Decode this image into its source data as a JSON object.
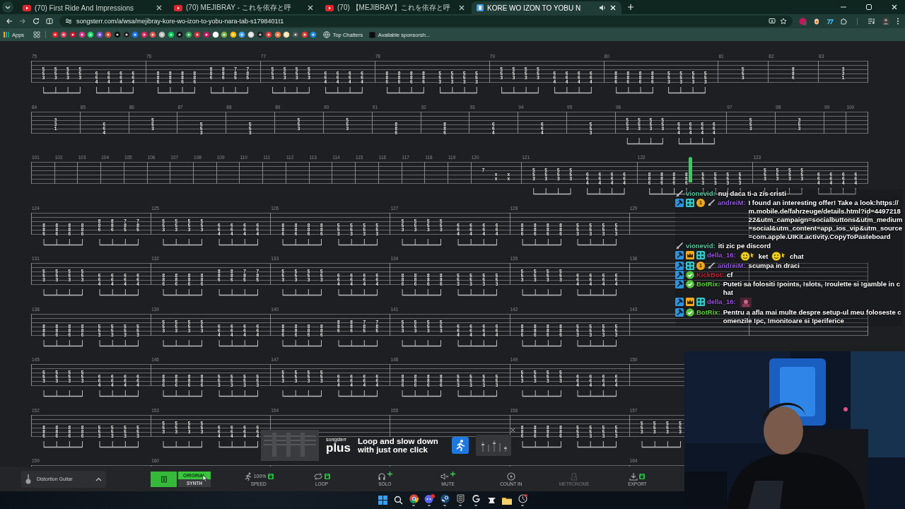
{
  "browser": {
    "tabs": [
      {
        "title": "(70) First Ride And Impressions",
        "kind": "video",
        "selected": false,
        "audio": false
      },
      {
        "title": "(70) MEJIBRAY - これを依存と呼",
        "kind": "video",
        "selected": false,
        "audio": false
      },
      {
        "title": "(70) 【MEJIBRAY】これを依存と呼",
        "kind": "video",
        "selected": false,
        "audio": false
      },
      {
        "title": "KORE WO IZON TO YOBU N",
        "kind": "site",
        "selected": true,
        "audio": true
      }
    ],
    "url": "songsterr.com/a/wsa/mejibray-kore-wo-izon-to-yobu-nara-tab-s1798401t1",
    "bookmarks": {
      "apps": "Apps",
      "links": [
        {
          "label": "Top Chatters"
        },
        {
          "label": "Available sponsorsh..."
        }
      ]
    }
  },
  "tab_sheet": {
    "systems": [
      {
        "measures": [
          {
            "number": "75",
            "chords": [
              "  553 ",
              "  553 ",
              "  553 ",
              "  553 ",
              "   664",
              "   664",
              "   664",
              "   664"
            ]
          },
          {
            "number": "76",
            "chords": [
              "   886",
              "   886",
              "   886",
              "   886",
              "  886 ",
              "  886 ",
              "  785 ",
              "  785 "
            ]
          },
          {
            "number": "77",
            "chords": [
              "  553 ",
              "  553 ",
              "  553 ",
              "  553 ",
              "   664",
              "   664",
              "   664",
              "   664"
            ]
          },
          {
            "number": "78",
            "chords": [
              "   886",
              "   886",
              "   886",
              "   886",
              "   553",
              "   553",
              "   553",
              "   553"
            ]
          },
          {
            "number": "79",
            "chords": [
              "  553 ",
              "  553 ",
              "  553 ",
              "  553 ",
              "   664",
              "   664",
              "   664",
              "   664"
            ]
          },
          {
            "number": "80",
            "chords": [
              "   886",
              "   886",
              "   886",
              "   886",
              "   553",
              "   553",
              "   553",
              "   553"
            ]
          },
          {
            "number": "81",
            "chords": [
              "  553 "
            ]
          },
          {
            "number": "82",
            "chords": [
              "  886 "
            ]
          },
          {
            "number": "83",
            "chords": [
              "  331 "
            ]
          }
        ]
      },
      {
        "measures": [
          {
            "number": "84",
            "chords": [
              "  331 "
            ]
          },
          {
            "number": "85",
            "chords": [
              "   664"
            ]
          },
          {
            "number": "86",
            "chords": [
              "  553 "
            ]
          },
          {
            "number": "87",
            "chords": [
              "   553"
            ]
          },
          {
            "number": "88",
            "chords": [
              "   553"
            ]
          },
          {
            "number": "89",
            "chords": [
              "  553 "
            ]
          },
          {
            "number": "90",
            "chords": [
              "  553 "
            ]
          },
          {
            "number": "91",
            "chords": [
              "   886"
            ]
          },
          {
            "number": "92",
            "chords": [
              "   886"
            ]
          },
          {
            "number": "93",
            "chords": [
              "   664"
            ]
          },
          {
            "number": "94",
            "chords": [
              "   664"
            ]
          },
          {
            "number": "95",
            "chords": [
              "   553"
            ]
          },
          {
            "number": "96",
            "chords": [
              "  553 ",
              "  553 ",
              "  553 ",
              "  553 ",
              "   664",
              "   664",
              "   664",
              "   664"
            ]
          },
          {
            "number": "97",
            "chords": [
              "  553 "
            ]
          },
          {
            "number": "98",
            "chords": [
              "  353 "
            ]
          },
          {
            "number": "99"
          },
          {
            "number": "100"
          }
        ]
      },
      {
        "measures": [
          {
            "number": "101"
          },
          {
            "number": "102"
          },
          {
            "number": "103"
          },
          {
            "number": "104"
          },
          {
            "number": "105"
          },
          {
            "number": "106"
          },
          {
            "number": "107"
          },
          {
            "number": "108"
          },
          {
            "number": "109"
          },
          {
            "number": "110"
          },
          {
            "number": "111"
          },
          {
            "number": "112"
          },
          {
            "number": "113"
          },
          {
            "number": "114"
          },
          {
            "number": "115"
          },
          {
            "number": "116"
          },
          {
            "number": "117"
          },
          {
            "number": "118"
          },
          {
            "number": "119"
          },
          {
            "number": "120",
            "chords": [
              "  7   ",
              "   x x",
              "   x x"
            ]
          },
          {
            "number": "121",
            "chords": [
              "  553 ",
              "  553 ",
              "  553 ",
              "  553 ",
              "   664",
              "   664",
              "   664",
              "   664"
            ]
          },
          {
            "number": "122",
            "chords": [
              "   886",
              "   886",
              "   886",
              "   886",
              "   553",
              "   553",
              "   553",
              "   553"
            ]
          },
          {
            "number": "123",
            "chords": [
              "  553 ",
              "  553 ",
              "  553 ",
              "  553 ",
              "   664",
              "   664",
              "   664",
              "   664"
            ]
          }
        ]
      },
      {
        "measures": [
          {
            "number": "124",
            "chords": [
              "   886",
              "   886",
              "   886",
              "   886",
              "  886 ",
              "  886 ",
              "  785 ",
              "  785 "
            ]
          },
          {
            "number": "125",
            "chords": [
              "  553 ",
              "  553 ",
              "  553 ",
              "  553 ",
              "   664",
              "   664",
              "   664",
              "   664"
            ]
          },
          {
            "number": "126",
            "chords": [
              "   886",
              "   886",
              "   886",
              "   886",
              "   553",
              "   553",
              "   553",
              "   553"
            ]
          },
          {
            "number": "127",
            "chords": [
              "  553 ",
              "  553 ",
              "  553 ",
              "  553 ",
              "   664",
              "   664",
              "   664",
              "   664"
            ]
          },
          {
            "number": "128",
            "chords": [
              "   886",
              "   886",
              "   886",
              "   886",
              "   553",
              "   553",
              "   553",
              "   553"
            ]
          },
          {
            "number": "129",
            "covered": true
          },
          {
            "covered": true
          }
        ]
      },
      {
        "measures": [
          {
            "number": "131",
            "chords": [
              "  553 ",
              "  553 ",
              "  553 ",
              "  553 ",
              "   664",
              "   664",
              "   664",
              "   664"
            ]
          },
          {
            "number": "132",
            "chords": [
              "   886",
              "   886",
              "   886",
              "   886",
              "  886 ",
              "  886 ",
              "  785 ",
              "  785 "
            ]
          },
          {
            "number": "133",
            "chords": [
              "  553 ",
              "  553 ",
              "  553 ",
              "  553 ",
              "   664",
              "   664",
              "   664",
              "   664"
            ]
          },
          {
            "number": "134",
            "chords": [
              "   886",
              "   886",
              "   886",
              "   886",
              "   553",
              "   553",
              "   553",
              "   553"
            ]
          },
          {
            "number": "135",
            "chords": [
              "  553 ",
              "  553 ",
              "  553 ",
              "  553 ",
              "   664",
              "   664",
              "   664",
              "   664"
            ]
          },
          {
            "number": "136",
            "covered": true
          },
          {
            "covered": true
          }
        ]
      },
      {
        "measures": [
          {
            "number": "138",
            "chords": [
              "   886",
              "   886",
              "   886",
              "   886",
              "   553",
              "   553",
              "   553",
              "   553"
            ]
          },
          {
            "number": "139",
            "chords": [
              "  553 ",
              "  553 ",
              "  553 ",
              "  553 ",
              "   664",
              "   664",
              "   664",
              "   664"
            ]
          },
          {
            "number": "140",
            "chords": [
              "   886",
              "   886",
              "   886",
              "   886",
              "  886 ",
              "  886 ",
              "  785 ",
              "  785 "
            ]
          },
          {
            "number": "141",
            "chords": [
              "  553 ",
              "  553 ",
              "  553 ",
              "  553 ",
              "   664",
              "   664",
              "   664",
              "   664"
            ]
          },
          {
            "number": "142",
            "chords": [
              "   886",
              "   886",
              "   886",
              "   886",
              "   553",
              "   553",
              "   553",
              "   553"
            ]
          },
          {
            "number": "143",
            "covered": true
          },
          {
            "covered": true
          }
        ]
      },
      {
        "measures": [
          {
            "number": "145",
            "chords": [
              "  553 ",
              "  553 ",
              "  553 ",
              "  553 ",
              "   664",
              "   664",
              "   664",
              "   664"
            ]
          },
          {
            "number": "146",
            "chords": [
              "   886",
              "   886",
              "   886",
              "   886",
              "   553",
              "   553",
              "   553",
              "   553"
            ]
          },
          {
            "number": "147",
            "chords": [
              "  553 ",
              "  553 ",
              "  553 ",
              "  553 ",
              "   664",
              "   664",
              "   664",
              "   664"
            ]
          },
          {
            "number": "148",
            "chords": [
              "   886",
              "   886",
              "   886",
              "   886",
              "   553",
              "   553",
              "   553",
              "   553"
            ]
          },
          {
            "number": "149",
            "chords": [
              "  553 ",
              "  553 ",
              "  553 ",
              "  553 ",
              "   664",
              "   664",
              "   664",
              "   664"
            ]
          },
          {
            "number": "150",
            "covered": true
          }
        ]
      },
      {
        "measures": [
          {
            "number": "152",
            "chords": [
              "   886",
              "   886",
              "   886",
              "   886",
              "   553",
              "   553",
              "   553",
              "   553"
            ]
          },
          {
            "number": "153",
            "chords": [
              "  553 ",
              "  553 ",
              "  553 ",
              "  553 ",
              "   664",
              "   664",
              "   664",
              "   664"
            ]
          },
          {
            "number": "154",
            "covered": true
          },
          {
            "number": "155",
            "covered": true
          },
          {
            "number": "156",
            "chords": [
              "   886",
              "   886",
              "   886",
              "   886",
              "   553",
              "   553",
              "   553",
              "   553"
            ]
          },
          {
            "number": "157",
            "chords": [
              "  553 ",
              "  553 ",
              "  553 ",
              "  553 "
            ],
            "covered": true
          }
        ]
      },
      {
        "measures": [
          {
            "number": "159",
            "covered": true
          },
          {
            "number": "160",
            "covered": true
          },
          {
            "covered": true
          },
          {
            "covered": true
          },
          {
            "covered": true
          },
          {
            "number": "164",
            "covered": true
          }
        ]
      }
    ]
  },
  "chat": {
    "messages": [
      {
        "user": "vionevid:",
        "color": "#5ec8a2",
        "badges": [
          {
            "kind": "sword"
          }
        ],
        "parts": [
          {
            "kind": "text",
            "text": "nuj daca ti-a zis cristi"
          }
        ]
      },
      {
        "user": "andreiM:",
        "color": "#8e5ad6",
        "badges": [
          {
            "kind": "mod"
          },
          {
            "kind": "gg"
          },
          {
            "kind": "tier",
            "label": "1"
          },
          {
            "kind": "sword"
          }
        ],
        "parts": [
          {
            "kind": "text",
            "text": "I found an interesting offer! Take a look:https://m.mobile.de/fahrzeuge/details.html?id=449721822&utm_campaign=socialbuttons&utm_medium=social&utm_content=app_ios_vip&utm_source=com.apple.UIKit.activity.CopyToPasteboard"
          }
        ]
      },
      {
        "user": "vionevid:",
        "color": "#5ec8a2",
        "badges": [
          {
            "kind": "sword"
          }
        ],
        "parts": [
          {
            "kind": "text",
            "text": "iti zic pe discord"
          }
        ]
      },
      {
        "user": "della_16:",
        "color": "#9a4fe0",
        "badges": [
          {
            "kind": "mod"
          },
          {
            "kind": "crown"
          },
          {
            "kind": "gg"
          }
        ],
        "parts": [
          {
            "kind": "emote"
          },
          {
            "kind": "text",
            "text": "ket"
          },
          {
            "kind": "emote"
          },
          {
            "kind": "text",
            "text": "chat"
          }
        ]
      },
      {
        "user": "andreiM:",
        "color": "#8e5ad6",
        "badges": [
          {
            "kind": "mod"
          },
          {
            "kind": "gg"
          },
          {
            "kind": "tier",
            "label": "1"
          },
          {
            "kind": "sword"
          }
        ],
        "parts": [
          {
            "kind": "text",
            "text": "scumpa in draci"
          }
        ]
      },
      {
        "user": "KickBot:",
        "color": "#c4283c",
        "badges": [
          {
            "kind": "mod"
          },
          {
            "kind": "verified"
          }
        ],
        "parts": [
          {
            "kind": "text",
            "text": "cf"
          }
        ]
      },
      {
        "user": "BotRix:",
        "color": "#5fd33a",
        "badges": [
          {
            "kind": "mod"
          },
          {
            "kind": "verified"
          }
        ],
        "parts": [
          {
            "kind": "text",
            "text": "Puteti sa folositi !points, !slots, !roulette si !gamble in chat"
          }
        ]
      },
      {
        "user": "della_16:",
        "color": "#9a4fe0",
        "badges": [
          {
            "kind": "mod"
          },
          {
            "kind": "crown"
          },
          {
            "kind": "gg"
          }
        ],
        "parts": [
          {
            "kind": "image_emote"
          }
        ]
      },
      {
        "user": "BotRix:",
        "color": "#5fd33a",
        "badges": [
          {
            "kind": "mod"
          },
          {
            "kind": "verified"
          }
        ],
        "parts": [
          {
            "kind": "text",
            "text": "Pentru a afla mai multe despre setup-ul meu foloseste comenzile !pc, !monitoare si !periferice"
          }
        ]
      }
    ]
  },
  "promo": {
    "brand_top": "songsterr",
    "brand_bottom": "plus",
    "headline": "Loop and slow down with just one click"
  },
  "player": {
    "instrument": "Distortion Guitar",
    "playing": true,
    "sound": [
      {
        "label": "ORIGINAL",
        "selected": true
      },
      {
        "label": "SYNTH",
        "selected": false
      }
    ],
    "tools": [
      {
        "kind": "speed",
        "label": "SPEED",
        "value": "100%",
        "disabled": false
      },
      {
        "kind": "loop",
        "label": "LOOP",
        "disabled": false
      },
      {
        "kind": "solo",
        "label": "SOLO",
        "disabled": false
      },
      {
        "kind": "mute",
        "label": "MUTE",
        "disabled": false
      },
      {
        "kind": "count_in",
        "label": "COUNT IN",
        "disabled": false
      },
      {
        "kind": "metronome",
        "label": "METRONOME",
        "disabled": true
      },
      {
        "kind": "export",
        "label": "EXPORT",
        "disabled": false
      }
    ]
  },
  "taskbar": {
    "apps": [
      {
        "kind": "windows",
        "running": false
      },
      {
        "kind": "search",
        "running": false
      },
      {
        "kind": "chrome",
        "running": true
      },
      {
        "kind": "discord",
        "running": true
      },
      {
        "kind": "steam",
        "running": true
      },
      {
        "kind": "epic",
        "running": true
      },
      {
        "kind": "logitech",
        "running": true
      },
      {
        "kind": "anvil",
        "running": false
      },
      {
        "kind": "folder",
        "running": false
      },
      {
        "kind": "app",
        "running": true
      }
    ]
  }
}
